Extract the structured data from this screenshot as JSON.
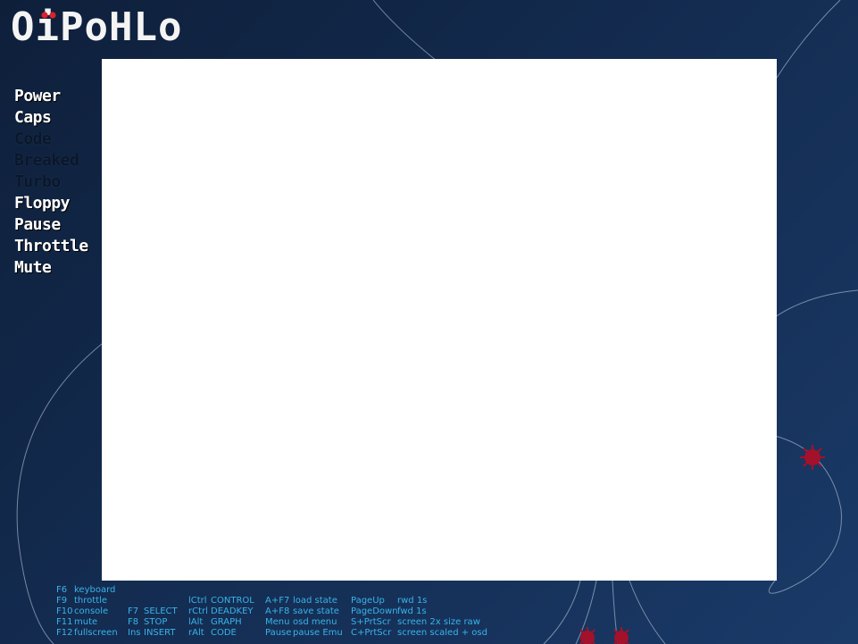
{
  "app": {
    "logo": "OiPoHLo"
  },
  "leds": [
    {
      "label": "Power",
      "on": true
    },
    {
      "label": "Caps",
      "on": true
    },
    {
      "label": "Code",
      "on": false
    },
    {
      "label": "Breaked",
      "on": false
    },
    {
      "label": "Turbo",
      "on": false
    },
    {
      "label": "Floppy",
      "on": true
    },
    {
      "label": "Pause",
      "on": true
    },
    {
      "label": "Throttle",
      "on": true
    },
    {
      "label": "Mute",
      "on": true
    }
  ],
  "colors": {
    "background_dark": "#0e1f3a",
    "background_light": "#1a3a68",
    "help_text": "#39b3ea",
    "led_on": "#ffffff",
    "led_off": "#0b1628",
    "logo_dot": "#d8232a",
    "bug": "#a3112a",
    "screen": "#ffffff"
  },
  "help": {
    "col1": [
      {
        "key": "F6",
        "action": "keyboard"
      },
      {
        "key": "F9",
        "action": "throttle"
      },
      {
        "key": "F10",
        "action": "console"
      },
      {
        "key": "F11",
        "action": "mute"
      },
      {
        "key": "F12",
        "action": "fullscreen"
      }
    ],
    "col2": [
      {
        "key": "F7",
        "action": "SELECT"
      },
      {
        "key": "F8",
        "action": "STOP"
      },
      {
        "key": "Ins",
        "action": "INSERT"
      }
    ],
    "col3": [
      {
        "key": "lCtrl",
        "action": "CONTROL"
      },
      {
        "key": "rCtrl",
        "action": "DEADKEY"
      },
      {
        "key": "lAlt",
        "action": "GRAPH"
      },
      {
        "key": "rAlt",
        "action": "CODE"
      }
    ],
    "col4": [
      {
        "key": "A+F7",
        "action": "load state"
      },
      {
        "key": "A+F8",
        "action": "save state"
      },
      {
        "key": "Menu",
        "action": "osd menu"
      },
      {
        "key": "Pause",
        "action": "pause Emu"
      }
    ],
    "col5": [
      {
        "key": "PageUp",
        "action": "rwd 1s"
      },
      {
        "key": "PageDown",
        "action": "fwd 1s"
      },
      {
        "key": "S+PrtScr",
        "action": "screen 2x size raw"
      },
      {
        "key": "C+PrtScr",
        "action": "screen scaled + osd"
      }
    ]
  }
}
